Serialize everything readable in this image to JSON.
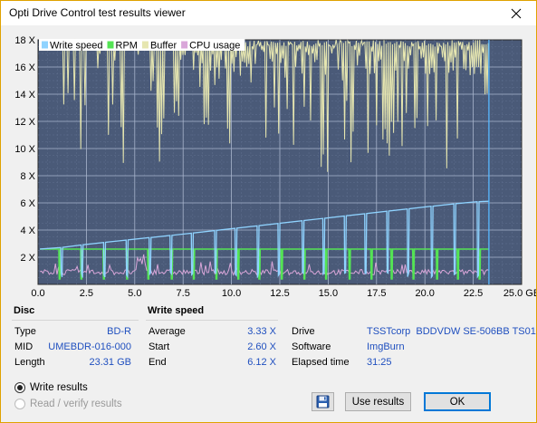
{
  "window": {
    "title": "Opti Drive Control test results viewer"
  },
  "legend": [
    {
      "label": "Write speed",
      "color": "#8fd3ff"
    },
    {
      "label": "RPM",
      "color": "#54e454"
    },
    {
      "label": "Buffer",
      "color": "#e6e6b0"
    },
    {
      "label": "CPU usage",
      "color": "#d9a6d9"
    }
  ],
  "chart_data": {
    "type": "line",
    "xlabel": "",
    "ylabel": "",
    "x_ticks": [
      "0.0",
      "2.5",
      "5.0",
      "7.5",
      "10.0",
      "12.5",
      "15.0",
      "17.5",
      "20.0",
      "22.5",
      "25.0 GB"
    ],
    "y_ticks": [
      "2 X",
      "4 X",
      "6 X",
      "8 X",
      "10 X",
      "12 X",
      "14 X",
      "16 X",
      "18 X"
    ],
    "xlim": [
      0,
      25
    ],
    "ylim": [
      0,
      18
    ],
    "background": "#4a5a78",
    "series": [
      {
        "name": "Write speed",
        "x": [
          0,
          0.5,
          1,
          2.5,
          5,
          7.5,
          10,
          12.5,
          15,
          17.5,
          20,
          22.5,
          23.31
        ],
        "values": [
          2.6,
          2.62,
          2.68,
          2.95,
          3.33,
          3.7,
          4.1,
          4.5,
          4.9,
          5.3,
          5.7,
          6.08,
          6.12
        ]
      },
      {
        "name": "RPM",
        "x": [
          0,
          23.31
        ],
        "values": [
          2.6,
          2.6
        ]
      },
      {
        "name": "Buffer",
        "x": [
          0,
          23.31
        ],
        "values": [
          18,
          14
        ]
      },
      {
        "name": "CPU usage",
        "x": [
          0,
          5,
          5.2,
          5.6,
          10,
          15,
          20,
          23.31
        ],
        "values": [
          0.6,
          0.8,
          2.2,
          0.7,
          0.8,
          0.9,
          1.0,
          0.9
        ]
      }
    ]
  },
  "disc": {
    "header": "Disc",
    "rows": [
      {
        "label": "Type",
        "value": "BD-R"
      },
      {
        "label": "MID",
        "value": "UMEBDR-016-000"
      },
      {
        "label": "Length",
        "value": "23.31 GB"
      }
    ]
  },
  "write_speed": {
    "header": "Write speed",
    "rows": [
      {
        "label": "Average",
        "value": "3.33 X"
      },
      {
        "label": "Start",
        "value": "2.60 X"
      },
      {
        "label": "End",
        "value": "6.12 X"
      }
    ]
  },
  "drive_info": {
    "rows": [
      {
        "label": "Drive",
        "value": "TSSTcorp  BDDVDW SE-506BB TS01"
      },
      {
        "label": "Software",
        "value": "ImgBurn"
      },
      {
        "label": "Elapsed time",
        "value": "31:25"
      }
    ]
  },
  "options": {
    "write_results": "Write results",
    "read_verify": "Read / verify results"
  },
  "buttons": {
    "use_results": "Use results",
    "ok": "OK"
  }
}
